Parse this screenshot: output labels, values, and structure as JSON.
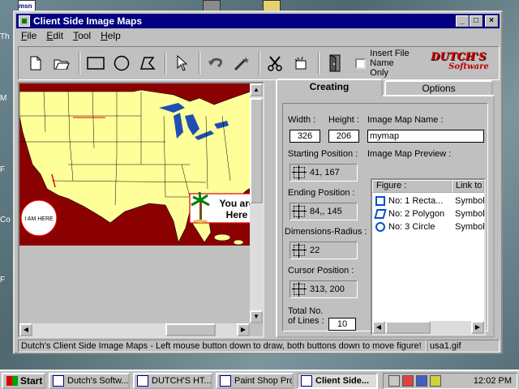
{
  "window": {
    "title": "Client Side Image Maps",
    "min_label": "_",
    "max_label": "□",
    "close_label": "×"
  },
  "menu": [
    {
      "key": "F",
      "rest": "ile"
    },
    {
      "key": "E",
      "rest": "dit"
    },
    {
      "key": "T",
      "rest": "ool"
    },
    {
      "key": "H",
      "rest": "elp"
    }
  ],
  "toolbar": {
    "insert_file_line1": "Insert File",
    "insert_file_line2": "Name Only",
    "logo_line1": "DUTCH'S",
    "logo_line2": "Software",
    "icons": [
      "new-file-icon",
      "open-folder-icon",
      "rectangle-tool-icon",
      "circle-tool-icon",
      "polygon-tool-icon",
      "pointer-icon",
      "undo-icon",
      "magic-wand-icon",
      "cut-icon",
      "insert-icon",
      "exit-door-icon"
    ]
  },
  "map": {
    "callout_text": "You are Here",
    "callout_line1": "You are",
    "callout_line2": "Here",
    "circle_text": "I AM HERE"
  },
  "tabs": {
    "creating": "Creating",
    "options": "Options"
  },
  "creating": {
    "width_label": "Width :",
    "width_value": "326",
    "height_label": "Height :",
    "height_value": "206",
    "name_label": "Image Map Name :",
    "name_value": "mymap",
    "start_label": "Starting Position :",
    "start_value": "41,   167",
    "end_label": "Ending Position :",
    "end_value": "84,,  145",
    "dim_label": "Dimensions-Radius :",
    "dim_value": "22",
    "cursor_label": "Cursor Position :",
    "cursor_value": "313,  200",
    "total_label_1": "Total No.",
    "total_label_2": "of Lines :",
    "total_value": "10",
    "preview_label": "Image Map Preview :",
    "list_headers": [
      "Figure :",
      "Link to g"
    ],
    "rows": [
      {
        "figure": "No: 1 Recta...",
        "link": "Symbolic",
        "shape": "rect"
      },
      {
        "figure": "No: 2 Polygon",
        "link": "Symbolic",
        "shape": "poly"
      },
      {
        "figure": "No: 3 Circle",
        "link": "Symbolic",
        "shape": "circle"
      }
    ]
  },
  "status": {
    "message": "Dutch's Client Side Image Maps - Left mouse button down to draw, both buttons down to move figure!",
    "file": "usa1.gif"
  },
  "taskbar": {
    "start": "Start",
    "tasks": [
      "Dutch's Softw...",
      "DUTCH'S HT...",
      "Paint Shop Pro",
      "Client Side..."
    ],
    "clock": "12:02 PM"
  },
  "desktop": {
    "edge_letters": [
      "Th",
      "M",
      "F",
      "Co",
      "F"
    ],
    "msn": "msn"
  },
  "colors": {
    "titlebar": "#000080",
    "map_land": "#ffff99",
    "map_water": "#8b0000",
    "map_lake": "#1e4fb0"
  }
}
